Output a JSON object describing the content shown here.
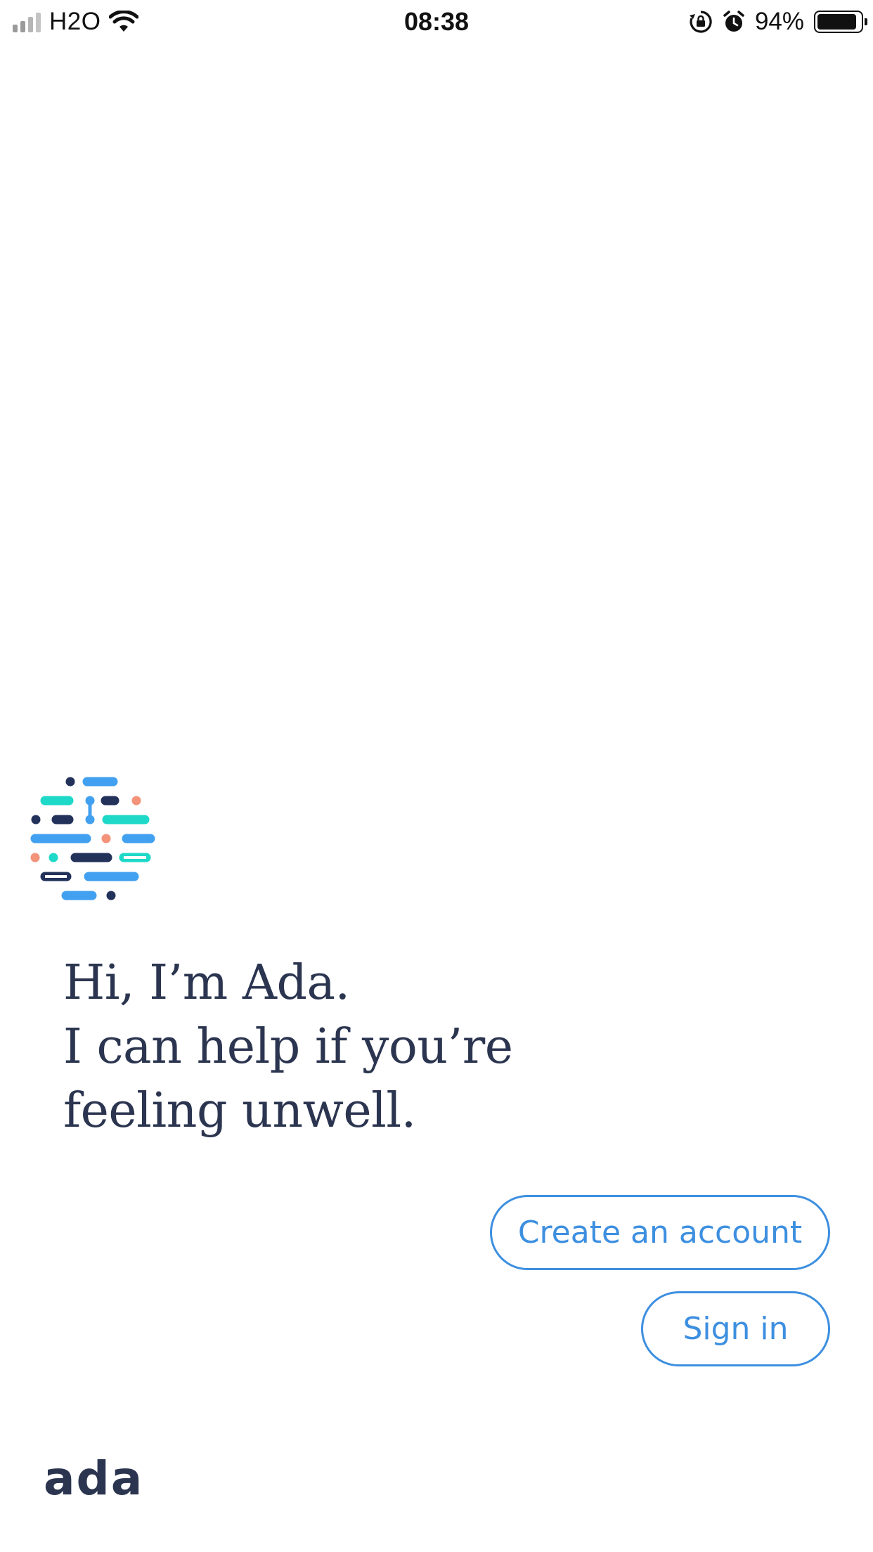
{
  "status_bar": {
    "carrier": "H2O",
    "time": "08:38",
    "battery_percent": "94%",
    "battery_level": 0.94,
    "icons": [
      "signal-icon",
      "wifi-icon",
      "orientation-lock-icon",
      "alarm-icon",
      "battery-icon"
    ]
  },
  "logo": {
    "icon": "ada-logo-mark"
  },
  "greeting": {
    "line1": "Hi, I’m Ada.",
    "line2": "I can help if you’re",
    "line3": "feeling unwell."
  },
  "actions": {
    "create_account_label": "Create an account",
    "sign_in_label": "Sign in"
  },
  "footer": {
    "wordmark": "ada"
  },
  "colors": {
    "text_dark": "#2b3550",
    "accent_blue": "#3d8fe0",
    "logo_navy": "#23325a",
    "logo_blue": "#42a0f0",
    "logo_teal": "#1ed8c8",
    "logo_orange": "#f3937a"
  }
}
